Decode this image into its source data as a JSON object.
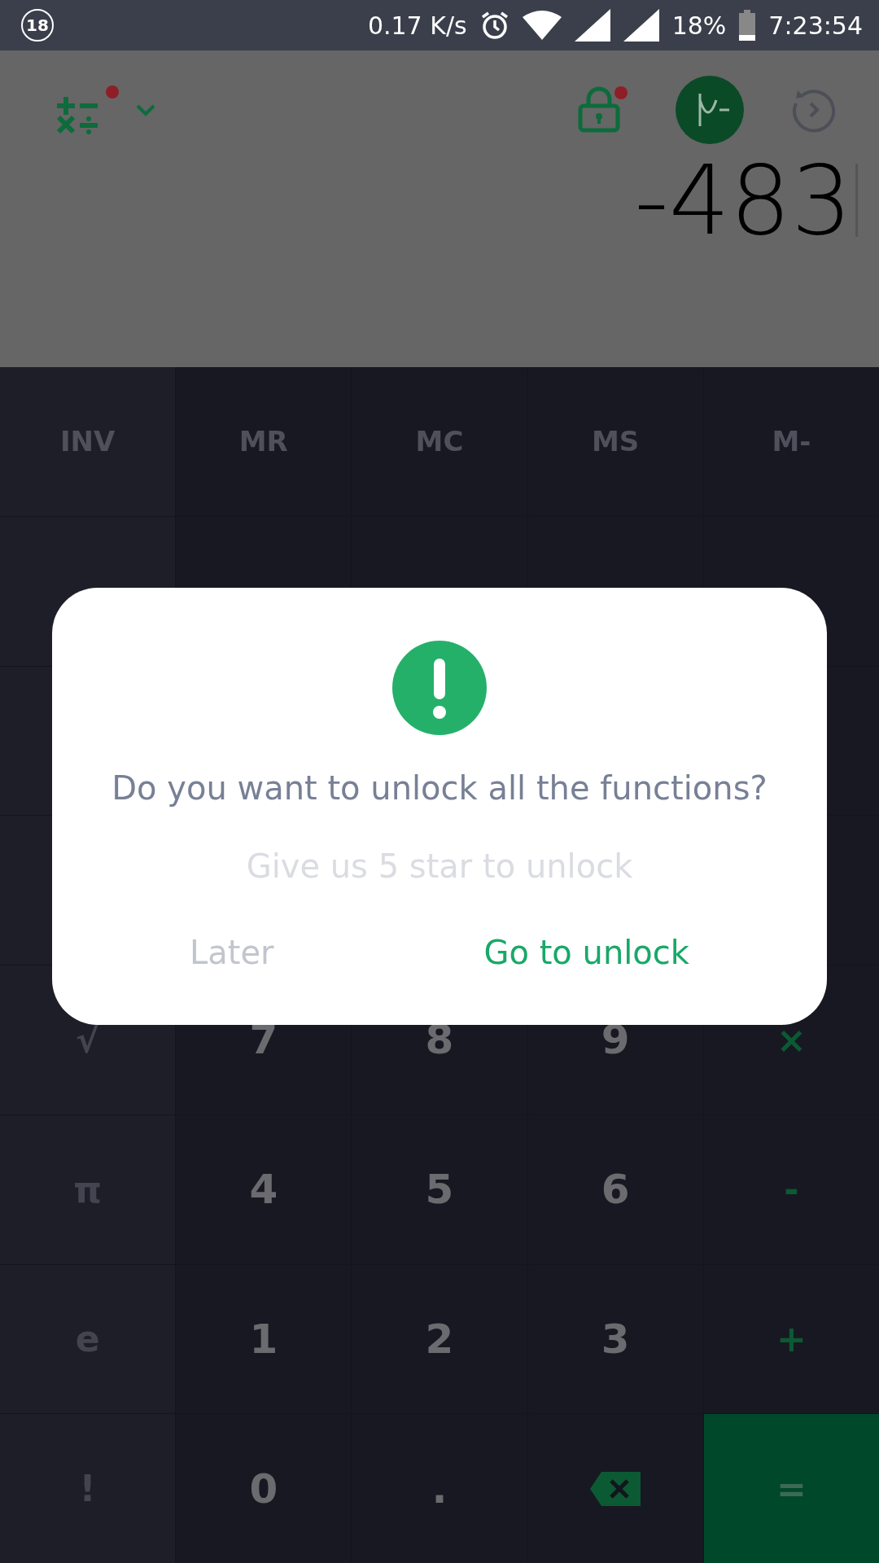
{
  "status_bar": {
    "badge": "18",
    "speed": "0.17 K/s",
    "battery": "18%",
    "time": "7:23:54"
  },
  "display": {
    "value": "-483"
  },
  "keys": [
    {
      "label": "INV",
      "kind": "function"
    },
    {
      "label": "MR",
      "kind": "function"
    },
    {
      "label": "MC",
      "kind": "function"
    },
    {
      "label": "MS",
      "kind": "function"
    },
    {
      "label": "M-",
      "kind": "function"
    },
    {
      "kind": "blank"
    },
    {
      "kind": "blank"
    },
    {
      "kind": "blank"
    },
    {
      "kind": "blank"
    },
    {
      "kind": "blank"
    },
    {
      "kind": "blank"
    },
    {
      "kind": "covered"
    },
    {
      "kind": "covered"
    },
    {
      "kind": "covered"
    },
    {
      "kind": "blank"
    },
    {
      "kind": "blank"
    },
    {
      "kind": "covered"
    },
    {
      "kind": "blank"
    },
    {
      "kind": "blank"
    },
    {
      "kind": "blank"
    },
    {
      "label": "√",
      "kind": "side"
    },
    {
      "label": "7",
      "kind": "digit"
    },
    {
      "label": "8",
      "kind": "digit"
    },
    {
      "label": "9",
      "kind": "digit"
    },
    {
      "label": "×",
      "kind": "operator"
    },
    {
      "label": "π",
      "kind": "side"
    },
    {
      "label": "4",
      "kind": "digit"
    },
    {
      "label": "5",
      "kind": "digit"
    },
    {
      "label": "6",
      "kind": "digit"
    },
    {
      "label": "-",
      "kind": "operator"
    },
    {
      "label": "e",
      "kind": "side"
    },
    {
      "label": "1",
      "kind": "digit"
    },
    {
      "label": "2",
      "kind": "digit"
    },
    {
      "label": "3",
      "kind": "digit"
    },
    {
      "label": "+",
      "kind": "operator"
    },
    {
      "label": "!",
      "kind": "side"
    },
    {
      "label": "0",
      "kind": "digit"
    },
    {
      "label": ".",
      "kind": "digit"
    },
    {
      "kind": "backspace"
    },
    {
      "label": "=",
      "kind": "equals"
    }
  ],
  "dialog": {
    "title": "Do you want to unlock all the functions?",
    "message": "Give us 5 star to unlock",
    "buttons": [
      {
        "label": "Later",
        "kind": "secondary"
      },
      {
        "label": "Go to unlock",
        "kind": "primary"
      }
    ]
  }
}
